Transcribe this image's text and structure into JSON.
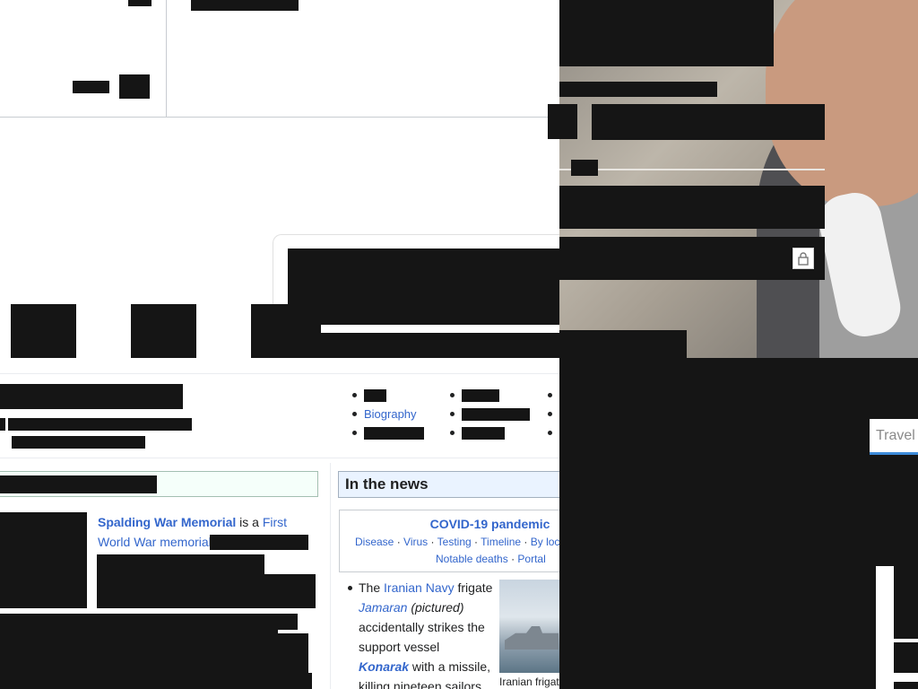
{
  "portal": {
    "links": [
      "Biography"
    ]
  },
  "featured": {
    "lead_title": "Spalding War Memorial",
    "lead_mid": " is a ",
    "lead_link1": "First",
    "lead_link2": "World War memorial"
  },
  "news": {
    "heading": "In the news",
    "box_title": "COVID-19 pandemic",
    "box_links_row1": [
      "Disease",
      "Virus",
      "Testing",
      "Timeline",
      "By loca"
    ],
    "box_links_row2": [
      "Notable deaths",
      "Portal"
    ],
    "sep": "·",
    "item": {
      "pre": "The ",
      "navy": "Iranian Navy",
      "frigate": " frigate",
      "ship": "Jamaran",
      "pictured": " (pictured)",
      "line3": "accidentally strikes the",
      "line4": "support vessel",
      "vessel": "Konarak",
      "line5_rest": " with a missile,",
      "line6": "killing nineteen sailors"
    },
    "caption": "Iranian frigat"
  },
  "travel": {
    "placeholder": "Travel"
  },
  "colors": {
    "link": "#3366cc",
    "redaction": "#151515",
    "featured_bg": "#f5fffa",
    "news_bg": "#f5faff"
  }
}
